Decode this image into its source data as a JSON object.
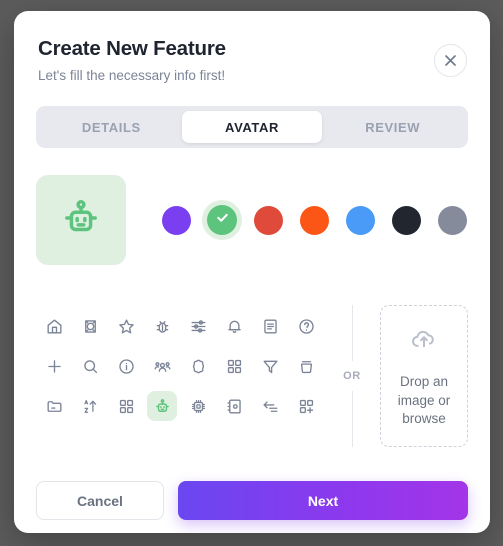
{
  "modal": {
    "title": "Create New Feature",
    "subtitle": "Let's fill the necessary info first!",
    "close_label": "×"
  },
  "tabs": [
    {
      "label": "DETAILS",
      "active": false
    },
    {
      "label": "AVATAR",
      "active": true
    },
    {
      "label": "REVIEW",
      "active": false
    }
  ],
  "preview": {
    "icon": "robot-icon",
    "icon_color": "#5cc47c",
    "background": "#dff0e1"
  },
  "colors": {
    "selected_index": 1,
    "swatches": [
      {
        "name": "purple",
        "hex": "#7b3ff2",
        "selected": false
      },
      {
        "name": "green",
        "hex": "#5cc47c",
        "selected": true
      },
      {
        "name": "red",
        "hex": "#df4a3a",
        "selected": false
      },
      {
        "name": "orange",
        "hex": "#fc5616",
        "selected": false
      },
      {
        "name": "blue",
        "hex": "#4a9bf7",
        "selected": false
      },
      {
        "name": "black",
        "hex": "#22262f",
        "selected": false
      },
      {
        "name": "gray",
        "hex": "#858b9b",
        "selected": false
      }
    ],
    "check_mark": "✓"
  },
  "icon_grid": {
    "selected_index": 19,
    "icons": [
      {
        "name": "home-icon"
      },
      {
        "name": "shield-badge-icon"
      },
      {
        "name": "star-icon"
      },
      {
        "name": "bug-icon"
      },
      {
        "name": "sliders-icon"
      },
      {
        "name": "bell-icon"
      },
      {
        "name": "document-icon"
      },
      {
        "name": "help-circle-icon"
      },
      {
        "name": "plus-icon"
      },
      {
        "name": "search-icon"
      },
      {
        "name": "info-circle-icon"
      },
      {
        "name": "users-group-icon"
      },
      {
        "name": "flower-badge-icon"
      },
      {
        "name": "grid-four-icon"
      },
      {
        "name": "filter-icon"
      },
      {
        "name": "trash-icon"
      },
      {
        "name": "folder-icon"
      },
      {
        "name": "sort-az-icon"
      },
      {
        "name": "layout-grid-icon"
      },
      {
        "name": "robot-icon"
      },
      {
        "name": "cpu-chip-icon"
      },
      {
        "name": "notebook-icon"
      },
      {
        "name": "arrow-left-bar-icon"
      },
      {
        "name": "grid-plus-icon"
      }
    ]
  },
  "divider": {
    "or_label": "OR"
  },
  "dropzone": {
    "icon": "cloud-upload-icon",
    "text": "Drop an image or browse"
  },
  "footer": {
    "cancel_label": "Cancel",
    "next_label": "Next"
  }
}
